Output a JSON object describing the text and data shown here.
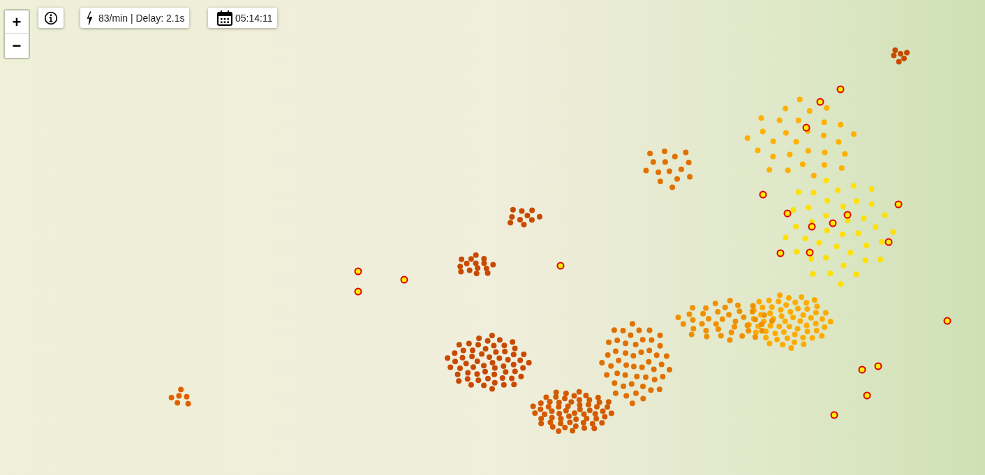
{
  "zoom_controls": [
    {
      "label": "+"
    },
    {
      "label": "−"
    }
  ],
  "strike_info": {
    "text": "83/min | Delay: 2.1s"
  },
  "clock": {
    "time": "05:14:11"
  }
}
